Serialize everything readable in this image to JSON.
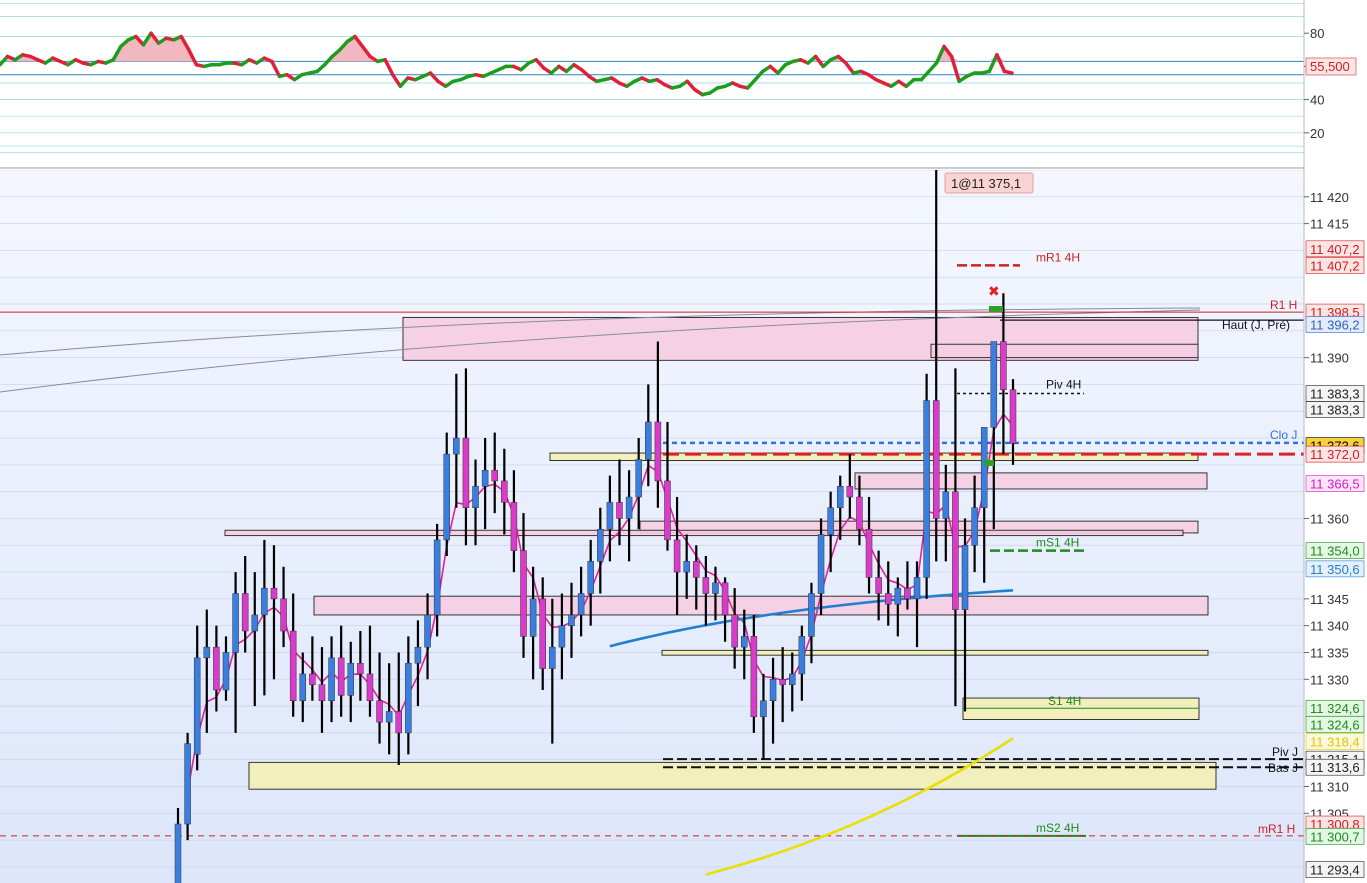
{
  "rsi": {
    "current_label": "55,500",
    "ticks": [
      {
        "label": "80",
        "value": 80
      },
      {
        "label": "60",
        "value": 60
      },
      {
        "label": "40",
        "value": 40
      },
      {
        "label": "20",
        "value": 20
      }
    ],
    "ylim": [
      0,
      100
    ],
    "values": [
      61,
      66,
      64,
      67,
      66,
      64,
      62,
      65,
      63,
      61,
      64,
      62,
      61,
      63,
      62,
      64,
      72,
      76,
      78,
      73,
      80,
      74,
      77,
      76,
      78,
      70,
      61,
      60,
      61,
      61,
      62,
      62,
      61,
      64,
      62,
      65,
      63,
      54,
      55,
      52,
      55,
      56,
      57,
      61,
      66,
      70,
      75,
      78,
      72,
      66,
      63,
      64,
      55,
      48,
      53,
      52,
      54,
      56,
      51,
      48,
      51,
      52,
      54,
      55,
      54,
      56,
      58,
      60,
      60,
      58,
      62,
      64,
      59,
      56,
      60,
      57,
      61,
      58,
      54,
      51,
      52,
      53,
      50,
      48,
      51,
      53,
      51,
      52,
      49,
      47,
      48,
      51,
      46,
      43,
      44,
      47,
      48,
      50,
      48,
      47,
      52,
      57,
      60,
      56,
      61,
      63,
      64,
      62,
      66,
      60,
      64,
      66,
      62,
      56,
      57,
      55,
      52,
      50,
      48,
      51,
      48,
      52,
      52,
      57,
      62,
      72,
      66,
      51,
      54,
      56,
      56,
      57,
      67,
      57,
      56
    ],
    "colors": {
      "up": "#1e9c1e",
      "down": "#e0203a",
      "fill": "#f2b8c0"
    }
  },
  "order_label": "1@11 375,1",
  "price_axis": {
    "min": 11292,
    "max": 11425,
    "ticks": [
      {
        "label": "11 420",
        "value": 11420
      },
      {
        "label": "11 415",
        "value": 11415
      },
      {
        "label": "11 390",
        "value": 11390
      },
      {
        "label": "11 360",
        "value": 11360
      },
      {
        "label": "11 345",
        "value": 11345
      },
      {
        "label": "11 340",
        "value": 11340
      },
      {
        "label": "11 335",
        "value": 11335
      },
      {
        "label": "11 330",
        "value": 11330
      },
      {
        "label": "11 310",
        "value": 11310
      },
      {
        "label": "11 305",
        "value": 11305
      }
    ]
  },
  "price_tags": [
    {
      "label": "11 407,2",
      "value": 11410.3,
      "color": "#d02020",
      "bg": "#fbe4e4"
    },
    {
      "label": "11 407,2",
      "value": 11407.2,
      "color": "#d02020",
      "bg": "#fbe4e4"
    },
    {
      "label": "11 398,5",
      "value": 11398.5,
      "color": "#d02020",
      "bg": "#fbe4e4"
    },
    {
      "label": "11 396,2",
      "value": 11396.2,
      "color": "#3060c0",
      "bg": "#e4ecfb"
    },
    {
      "label": "11 383,3",
      "value": 11383.3,
      "color": "#222222",
      "bg": "#f4f4f4"
    },
    {
      "label": "11 383,3",
      "value": 11380.3,
      "color": "#222222",
      "bg": "#f4f4f4"
    },
    {
      "label": "11 373,6",
      "value": 11373.6,
      "color": "#000000",
      "bg": "#f7d23c"
    },
    {
      "label": "11 372,0",
      "value": 11372.0,
      "color": "#d02020",
      "bg": "#fbe4e4"
    },
    {
      "label": "11 366,5",
      "value": 11366.5,
      "color": "#d020c0",
      "bg": "#fbe4f8"
    },
    {
      "label": "11 354,0",
      "value": 11354.0,
      "color": "#1e8c1e",
      "bg": "#e4f6e4"
    },
    {
      "label": "11 350,6",
      "value": 11350.6,
      "color": "#2080d0",
      "bg": "#e4f0fb"
    },
    {
      "label": "11 324,6",
      "value": 11324.6,
      "color": "#1e8c1e",
      "bg": "#e4f6e4"
    },
    {
      "label": "11 324,6",
      "value": 11321.6,
      "color": "#1e8c1e",
      "bg": "#e4f6e4"
    },
    {
      "label": "11 318,4",
      "value": 11318.4,
      "color": "#e0c800",
      "bg": "#fbf8e0"
    },
    {
      "label": "11 315,1",
      "value": 11315.1,
      "color": "#222222",
      "bg": "#f4f4f4"
    },
    {
      "label": "11 313,6",
      "value": 11313.6,
      "color": "#222222",
      "bg": "#f4f4f4"
    },
    {
      "label": "11 300,8",
      "value": 11303.0,
      "color": "#d02020",
      "bg": "#fbe4e4"
    },
    {
      "label": "11 300,7",
      "value": 11300.7,
      "color": "#1e8c1e",
      "bg": "#e4f6e4"
    },
    {
      "label": "11 293,4",
      "value": 11294.5,
      "color": "#222222",
      "bg": "#f4f4f4"
    }
  ],
  "levels": [
    {
      "label": "mR1 4H",
      "value": 11407.2,
      "color": "#d02020"
    },
    {
      "label": "R1 H",
      "value": 11398.5,
      "color": "#d02020"
    },
    {
      "label": "Haut (J, Pré)",
      "value": 11397.0,
      "color": "#111111"
    },
    {
      "label": "Piv 4H",
      "value": 11383.3,
      "color": "#111111"
    },
    {
      "label": "Clo J",
      "value": 11374.1,
      "color": "#3070e0"
    },
    {
      "label": "mS1 4H",
      "value": 11354.0,
      "color": "#1e8c1e"
    },
    {
      "label": "S1 4H",
      "value": 11324.6,
      "color": "#1e8c1e"
    },
    {
      "label": "Piv J",
      "value": 11315.1,
      "color": "#111111"
    },
    {
      "label": "Bas J",
      "value": 11313.6,
      "color": "#111111"
    },
    {
      "label": "mS2 4H",
      "value": 11300.8,
      "color": "#1e8c1e"
    },
    {
      "label": "mR1 H",
      "value": 11300.8,
      "color": "#d02020"
    }
  ],
  "zones": [
    {
      "low": 11389.5,
      "high": 11397.5,
      "fill": "#f6cde3",
      "from": 403,
      "to": 1198
    },
    {
      "low": 11390.0,
      "high": 11392.5,
      "fill": "#f6cde3",
      "from": 931,
      "to": 1198
    },
    {
      "low": 11365.5,
      "high": 11368.5,
      "fill": "#f6cde3",
      "from": 855,
      "to": 1207
    },
    {
      "low": 11370.8,
      "high": 11372.2,
      "fill": "#f3f0b5",
      "from": 550,
      "to": 1198
    },
    {
      "low": 11357.3,
      "high": 11359.5,
      "fill": "#f6cde3",
      "from": 640,
      "to": 1198
    },
    {
      "low": 11356.8,
      "high": 11357.8,
      "fill": "#f6cde3",
      "from": 225,
      "to": 1183
    },
    {
      "low": 11342.0,
      "high": 11345.5,
      "fill": "#f6cde3",
      "from": 314,
      "to": 1208
    },
    {
      "low": 11334.5,
      "high": 11335.4,
      "fill": "#f3f0b5",
      "from": 662,
      "to": 1208
    },
    {
      "low": 11322.5,
      "high": 11326.5,
      "fill": "#f3f0b5",
      "from": 963,
      "to": 1199
    },
    {
      "low": 11309.5,
      "high": 11314.5,
      "fill": "#f3f0b5",
      "from": 249,
      "to": 1216
    }
  ],
  "chart_data": {
    "type": "candlestick",
    "series": [
      {
        "name": "",
        "candles": [
          [
            11290,
            11306,
            11291,
            11303
          ],
          [
            11303,
            11320,
            11300,
            11318
          ],
          [
            11316,
            11340,
            11313,
            11334
          ],
          [
            11334,
            11343,
            11320,
            11336
          ],
          [
            11336,
            11340,
            11324,
            11328
          ],
          [
            11328,
            11338,
            11326,
            11335
          ],
          [
            11335,
            11350,
            11320,
            11346
          ],
          [
            11346,
            11353,
            11335,
            11339
          ],
          [
            11339,
            11350,
            11325,
            11342
          ],
          [
            11342,
            11356,
            11327,
            11347
          ],
          [
            11347,
            11355,
            11330,
            11345
          ],
          [
            11345,
            11351,
            11336,
            11339
          ],
          [
            11339,
            11346,
            11323,
            11326
          ],
          [
            11326,
            11335,
            11322,
            11331
          ],
          [
            11331,
            11338,
            11326,
            11329
          ],
          [
            11329,
            11336,
            11320,
            11326
          ],
          [
            11326,
            11338,
            11322,
            11334
          ],
          [
            11334,
            11340,
            11323,
            11327
          ],
          [
            11327,
            11337,
            11322,
            11333
          ],
          [
            11333,
            11339,
            11326,
            11331
          ],
          [
            11331,
            11340,
            11323,
            11326
          ],
          [
            11326,
            11335,
            11318,
            11322
          ],
          [
            11322,
            11333,
            11316,
            11324
          ],
          [
            11324,
            11335,
            11314,
            11320
          ],
          [
            11320,
            11338,
            11316,
            11333
          ],
          [
            11333,
            11341,
            11325,
            11336
          ],
          [
            11336,
            11346,
            11330,
            11342
          ],
          [
            11342,
            11359,
            11338,
            11356
          ],
          [
            11356,
            11376,
            11353,
            11372
          ],
          [
            11372,
            11387,
            11362,
            11375
          ],
          [
            11375,
            11388,
            11355,
            11362
          ],
          [
            11362,
            11371,
            11355,
            11366
          ],
          [
            11366,
            11375,
            11358,
            11369
          ],
          [
            11369,
            11376,
            11361,
            11367
          ],
          [
            11367,
            11373,
            11357,
            11363
          ],
          [
            11363,
            11369,
            11350,
            11354
          ],
          [
            11354,
            11361,
            11334,
            11338
          ],
          [
            11338,
            11351,
            11330,
            11345
          ],
          [
            11345,
            11349,
            11328,
            11332
          ],
          [
            11332,
            11345,
            11318,
            11336
          ],
          [
            11336,
            11346,
            11330,
            11340
          ],
          [
            11340,
            11348,
            11334,
            11342
          ],
          [
            11342,
            11351,
            11338,
            11346
          ],
          [
            11346,
            11356,
            11340,
            11352
          ],
          [
            11352,
            11362,
            11346,
            11358
          ],
          [
            11358,
            11368,
            11352,
            11363
          ],
          [
            11363,
            11371,
            11355,
            11360
          ],
          [
            11360,
            11369,
            11352,
            11364
          ],
          [
            11364,
            11375,
            11358,
            11371
          ],
          [
            11371,
            11385,
            11366,
            11378
          ],
          [
            11378,
            11393,
            11362,
            11367
          ],
          [
            11367,
            11378,
            11354,
            11356
          ],
          [
            11356,
            11364,
            11342,
            11350
          ],
          [
            11350,
            11357,
            11345,
            11352
          ],
          [
            11352,
            11355,
            11343,
            11349
          ],
          [
            11349,
            11353,
            11340,
            11346
          ],
          [
            11346,
            11351,
            11341,
            11348
          ],
          [
            11348,
            11349,
            11337,
            11342
          ],
          [
            11342,
            11347,
            11332,
            11336
          ],
          [
            11336,
            11343,
            11330,
            11338
          ],
          [
            11338,
            11342,
            11320,
            11323
          ],
          [
            11323,
            11331,
            11315,
            11326
          ],
          [
            11326,
            11334,
            11318,
            11330
          ],
          [
            11330,
            11336,
            11322,
            11329
          ],
          [
            11329,
            11335,
            11324,
            11331
          ],
          [
            11331,
            11340,
            11326,
            11338
          ],
          [
            11338,
            11348,
            11333,
            11346
          ],
          [
            11346,
            11360,
            11342,
            11357
          ],
          [
            11357,
            11365,
            11350,
            11362
          ],
          [
            11362,
            11368,
            11356,
            11366
          ],
          [
            11366,
            11372,
            11360,
            11364
          ],
          [
            11364,
            11368,
            11355,
            11358
          ],
          [
            11358,
            11364,
            11346,
            11349
          ],
          [
            11349,
            11354,
            11341,
            11346
          ],
          [
            11346,
            11352,
            11340,
            11344
          ],
          [
            11344,
            11349,
            11338,
            11347
          ],
          [
            11347,
            11352,
            11343,
            11345
          ],
          [
            11345,
            11352,
            11336,
            11349
          ],
          [
            11349,
            11387,
            11345,
            11382
          ],
          [
            11382,
            11425,
            11352,
            11360
          ],
          [
            11360,
            11370,
            11352,
            11365
          ],
          [
            11365,
            11388,
            11325,
            11343
          ],
          [
            11343,
            11360,
            11324,
            11355
          ],
          [
            11355,
            11368,
            11350,
            11362
          ],
          [
            11362,
            11376,
            11348,
            11377
          ],
          [
            11377,
            11392,
            11358,
            11393
          ],
          [
            11393,
            11402,
            11372,
            11384
          ],
          [
            11384,
            11386,
            11370,
            11374
          ]
        ]
      }
    ],
    "ma_fast_color": "#e020a0",
    "ma_mid_color": "#2080d0",
    "ma_slow_color": "#e8e000",
    "up_color": "#3a7fe0",
    "down_color": "#d83cc8"
  }
}
